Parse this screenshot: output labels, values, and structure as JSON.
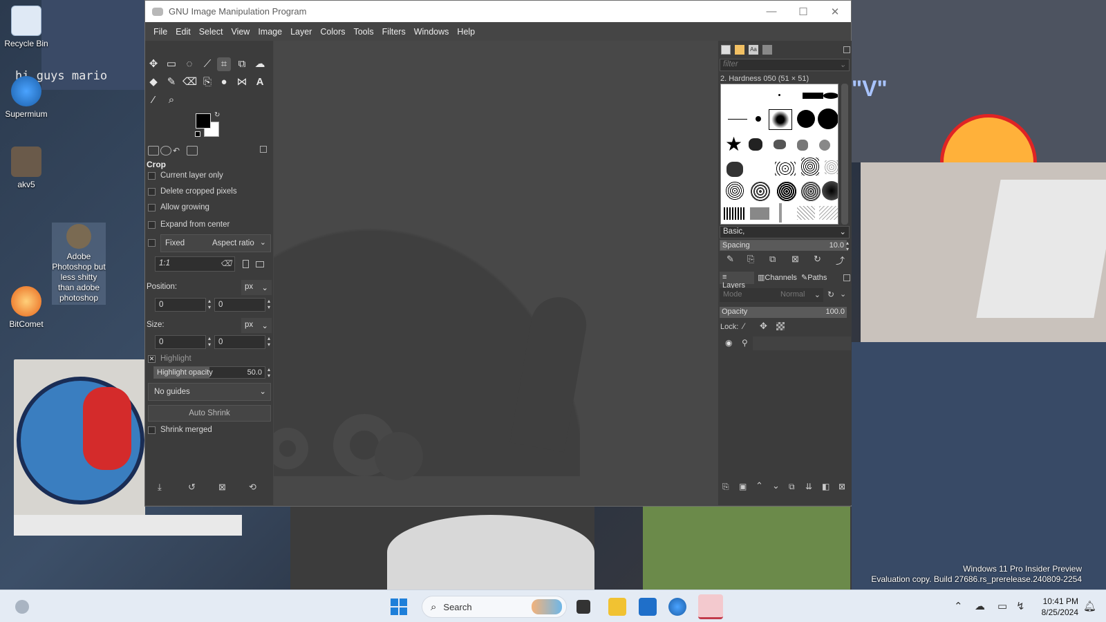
{
  "desktop": {
    "icons": [
      {
        "label": "Recycle Bin",
        "icon": "recycle-bin-icon"
      },
      {
        "label": "Supermium",
        "icon": "supermium-icon"
      },
      {
        "label": "akv5",
        "icon": "akv5-icon"
      },
      {
        "label": "Adobe Photoshop but less shitty than adobe photoshop",
        "icon": "gimp-shortcut-icon"
      },
      {
        "label": "BitComet",
        "icon": "bitcomet-icon"
      }
    ],
    "wallpaper_text": "hi guys mario",
    "wallpaper_v": "\"V\"",
    "watermark": {
      "line1": "Windows 11 Pro Insider Preview",
      "line2": "Evaluation copy. Build 27686.rs_prerelease.240809-2254"
    }
  },
  "window": {
    "title": "GNU Image Manipulation Program",
    "controls": {
      "minimize": "—",
      "maximize": "☐",
      "close": "✕"
    }
  },
  "menu": [
    "File",
    "Edit",
    "Select",
    "View",
    "Image",
    "Layer",
    "Colors",
    "Tools",
    "Filters",
    "Windows",
    "Help"
  ],
  "tool_options": {
    "title": "Crop",
    "current_layer_only": "Current layer only",
    "delete_cropped_pixels": "Delete cropped pixels",
    "allow_growing": "Allow growing",
    "expand_from_center": "Expand from center",
    "fixed_label": "Fixed",
    "fixed_mode": "Aspect ratio",
    "ratio_value": "1:1",
    "position_label": "Position:",
    "position_unit": "px",
    "position_x": "0",
    "position_y": "0",
    "size_label": "Size:",
    "size_unit": "px",
    "size_w": "0",
    "size_h": "0",
    "highlight_label": "Highlight",
    "highlight_opacity_label": "Highlight opacity",
    "highlight_opacity_value": "50.0",
    "guides": "No guides",
    "auto_shrink": "Auto Shrink",
    "shrink_merged": "Shrink merged"
  },
  "brushes": {
    "filter_placeholder": "filter",
    "selected": "2. Hardness 050 (51 × 51)",
    "tag": "Basic,",
    "spacing_label": "Spacing",
    "spacing_value": "10.0"
  },
  "layers": {
    "tabs": [
      "Layers",
      "Channels",
      "Paths"
    ],
    "mode_label": "Mode",
    "mode_value": "Normal",
    "opacity_label": "Opacity",
    "opacity_value": "100.0",
    "lock_label": "Lock:"
  },
  "taskbar": {
    "search_placeholder": "Search",
    "time": "10:41 PM",
    "date": "8/25/2024"
  }
}
